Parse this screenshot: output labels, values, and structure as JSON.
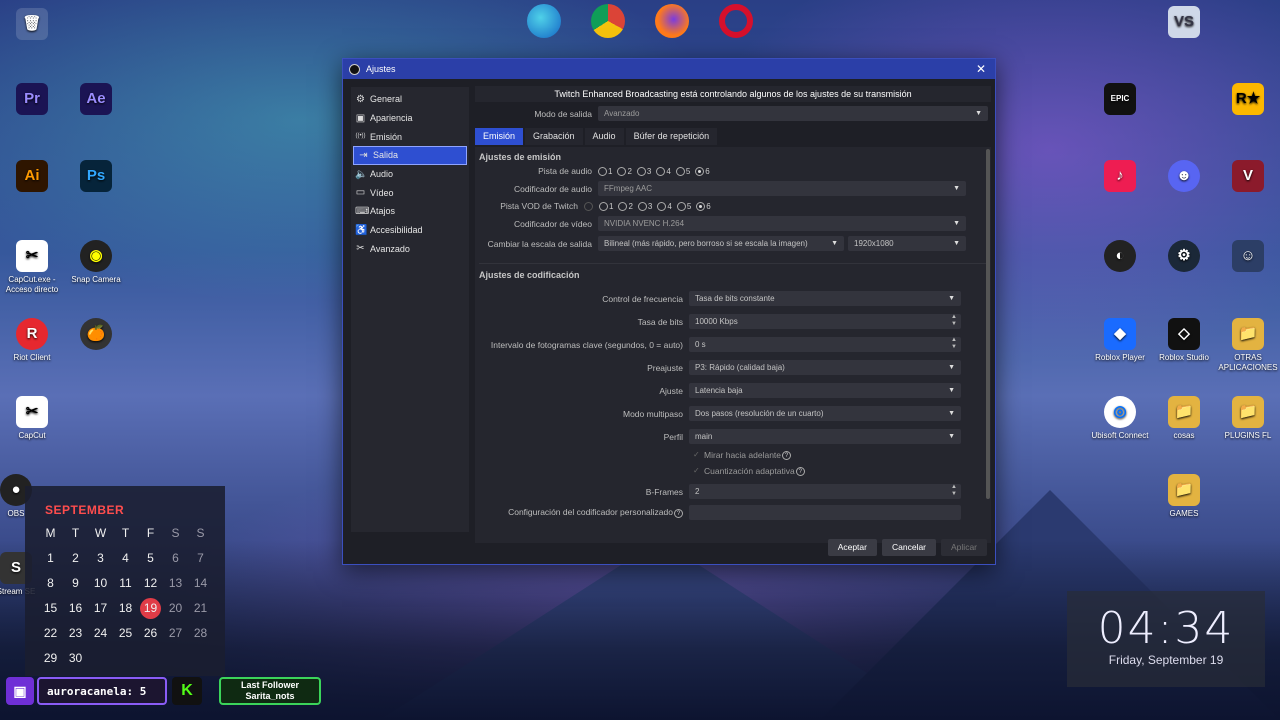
{
  "desktop": {
    "icons": [
      {
        "label": "",
        "glyph": "🗑"
      },
      {
        "label": "",
        "glyph": "Pr"
      },
      {
        "label": "",
        "glyph": "Ae"
      },
      {
        "label": "",
        "glyph": "Ai"
      },
      {
        "label": "",
        "glyph": "Ps"
      },
      {
        "label": "CapCut.exe - Acceso directo",
        "glyph": "✂"
      },
      {
        "label": "Snap Camera",
        "glyph": "◉"
      },
      {
        "label": "Riot Client",
        "glyph": "R"
      },
      {
        "label": "",
        "glyph": "🍊"
      },
      {
        "label": "CapCut",
        "glyph": "✂"
      },
      {
        "label": "OBS",
        "glyph": "●"
      },
      {
        "label": "Stream SE",
        "glyph": "S"
      },
      {
        "label": "",
        "glyph": "VS"
      },
      {
        "label": "",
        "glyph": "EPIC"
      },
      {
        "label": "",
        "glyph": "R★"
      },
      {
        "label": "",
        "glyph": "♪"
      },
      {
        "label": "",
        "glyph": "☻"
      },
      {
        "label": "",
        "glyph": "V"
      },
      {
        "label": "",
        "glyph": "◐"
      },
      {
        "label": "",
        "glyph": "⚙"
      },
      {
        "label": "",
        "glyph": "☺"
      },
      {
        "label": "Roblox Player",
        "glyph": "◆"
      },
      {
        "label": "Roblox Studio",
        "glyph": "◇"
      },
      {
        "label": "OTRAS APLICACIONES",
        "glyph": "📁"
      },
      {
        "label": "Ubisoft Connect",
        "glyph": "◎"
      },
      {
        "label": "cosas",
        "glyph": "📁"
      },
      {
        "label": "PLUGINS FL",
        "glyph": "📁"
      },
      {
        "label": "GAMES",
        "glyph": "📁"
      }
    ]
  },
  "window": {
    "title": "Ajustes",
    "close": "✕"
  },
  "sidebar": {
    "items": [
      {
        "label": "General",
        "icon": "⚙"
      },
      {
        "label": "Apariencia",
        "icon": "▣"
      },
      {
        "label": "Emisión",
        "icon": "((•))"
      },
      {
        "label": "Salida",
        "icon": "⇥"
      },
      {
        "label": "Audio",
        "icon": "🔈"
      },
      {
        "label": "Vídeo",
        "icon": "▭"
      },
      {
        "label": "Atajos",
        "icon": "⌨"
      },
      {
        "label": "Accesibilidad",
        "icon": "♿"
      },
      {
        "label": "Avanzado",
        "icon": "✂"
      }
    ]
  },
  "content": {
    "banner": "Twitch Enhanced Broadcasting está controlando algunos de los ajustes de su transmisión",
    "output_mode_label": "Modo de salida",
    "output_mode_value": "Avanzado",
    "tabs": [
      "Emisión",
      "Grabación",
      "Audio",
      "Búfer de repetición"
    ],
    "emission_title": "Ajustes de emisión",
    "audio_track_label": "Pista de audio",
    "audio_tracks": [
      "1",
      "2",
      "3",
      "4",
      "5",
      "6"
    ],
    "audio_encoder_label": "Codificador de audio",
    "audio_encoder_value": "FFmpeg AAC",
    "vod_track_label": "Pista VOD de Twitch",
    "video_encoder_label": "Codificador de vídeo",
    "video_encoder_value": "NVIDIA NVENC H.264",
    "rescale_label": "Cambiar la escala de salida",
    "rescale_value": "Bilineal (más rápido, pero borroso si se escala la imagen)",
    "rescale_resolution": "1920x1080",
    "encoding_title": "Ajustes de codificación",
    "rate_control_label": "Control de frecuencia",
    "rate_control_value": "Tasa de bits constante",
    "bitrate_label": "Tasa de bits",
    "bitrate_value": "10000 Kbps",
    "keyframe_label": "Intervalo de fotogramas clave (segundos, 0 = auto)",
    "keyframe_value": "0 s",
    "preset_label": "Preajuste",
    "preset_value": "P3: Rápido (calidad baja)",
    "tune_label": "Ajuste",
    "tune_value": "Latencia baja",
    "multipass_label": "Modo multipaso",
    "multipass_value": "Dos pasos (resolución de un cuarto)",
    "profile_label": "Perfil",
    "profile_value": "main",
    "lookahead_label": "Mirar hacia adelante",
    "adaptive_label": "Cuantización adaptativa",
    "bframes_label": "B-Frames",
    "bframes_value": "2",
    "custom_label": "Configuración del codificador personalizado"
  },
  "buttons": {
    "accept": "Aceptar",
    "cancel": "Cancelar",
    "apply": "Aplicar"
  },
  "calendar": {
    "month": "SEPTEMBER",
    "weekdays": [
      "M",
      "T",
      "W",
      "T",
      "F",
      "S",
      "S"
    ],
    "days": [
      "1",
      "2",
      "3",
      "4",
      "5",
      "6",
      "7",
      "8",
      "9",
      "10",
      "11",
      "12",
      "13",
      "14",
      "15",
      "16",
      "17",
      "18",
      "19",
      "20",
      "21",
      "22",
      "23",
      "24",
      "25",
      "26",
      "27",
      "28",
      "29",
      "30"
    ],
    "today": "19"
  },
  "clock": {
    "time": "04:34",
    "date": "Friday, September 19"
  },
  "stream_bar": {
    "chat_text": "auroracanela: 5",
    "follower_title": "Last Follower",
    "follower_name": "Sarita_nots"
  },
  "colors": {
    "accent": "#2e4fd1",
    "titlebar": "#2b3fa8",
    "today": "#e03c47",
    "month": "#ff4d4d"
  }
}
